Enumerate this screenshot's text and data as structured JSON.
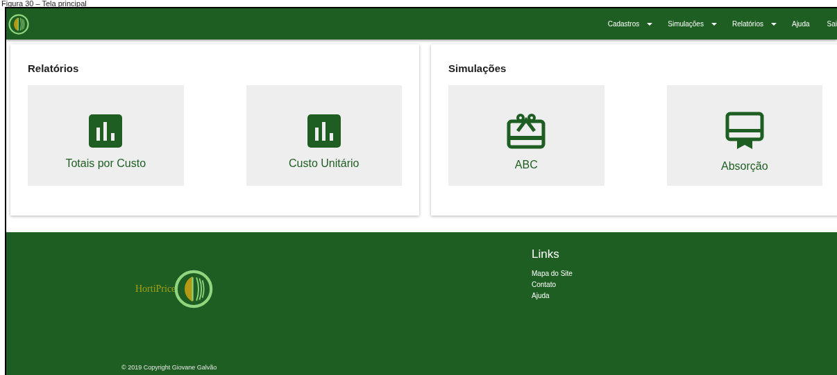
{
  "caption": "Figura 30 – Tela principal",
  "nav": {
    "items": [
      {
        "label": "Cadastros",
        "dropdown": true
      },
      {
        "label": "Simulações",
        "dropdown": true
      },
      {
        "label": "Relatórios",
        "dropdown": true
      },
      {
        "label": "Ajuda",
        "dropdown": false
      },
      {
        "label": "Sai",
        "dropdown": false
      }
    ]
  },
  "sections": [
    {
      "title": "Relatórios",
      "tiles": [
        {
          "label": "Totais por Custo",
          "kind": "chart"
        },
        {
          "label": "Custo Unitário",
          "kind": "chart"
        }
      ]
    },
    {
      "title": "Simulações",
      "tiles": [
        {
          "label": "ABC",
          "kind": "gift"
        },
        {
          "label": "Absorção",
          "kind": "ribbon"
        }
      ]
    }
  ],
  "footer": {
    "brand": "HortiPrice",
    "links_title": "Links",
    "links": [
      "Mapa do Site",
      "Contato",
      "Ajuda"
    ],
    "copyright": "© 2019 Copyright Giovane Galvão"
  }
}
